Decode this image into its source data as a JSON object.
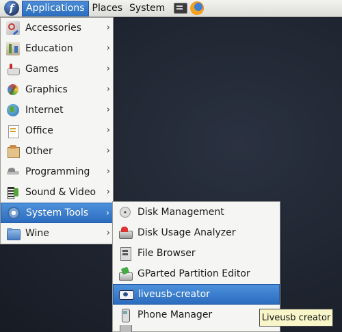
{
  "panel": {
    "menus": [
      "Applications",
      "Places",
      "System"
    ],
    "icons": [
      "fedora-logo-icon",
      "terminal-icon",
      "firefox-icon"
    ],
    "logo_letter": "f"
  },
  "applications_menu": {
    "items": [
      {
        "label": "Accessories",
        "icon": "accessories-icon"
      },
      {
        "label": "Education",
        "icon": "education-icon"
      },
      {
        "label": "Games",
        "icon": "games-icon"
      },
      {
        "label": "Graphics",
        "icon": "graphics-icon"
      },
      {
        "label": "Internet",
        "icon": "internet-icon"
      },
      {
        "label": "Office",
        "icon": "office-icon"
      },
      {
        "label": "Other",
        "icon": "other-icon"
      },
      {
        "label": "Programming",
        "icon": "programming-icon"
      },
      {
        "label": "Sound & Video",
        "icon": "sound-video-icon"
      },
      {
        "label": "System Tools",
        "icon": "system-tools-icon",
        "highlighted": true
      },
      {
        "label": "Wine",
        "icon": "wine-folder-icon"
      }
    ],
    "chevron": "›"
  },
  "system_tools_menu": {
    "items": [
      {
        "label": "Disk Management",
        "icon": "disk-icon"
      },
      {
        "label": "Disk Usage Analyzer",
        "icon": "disk-usage-icon"
      },
      {
        "label": "File Browser",
        "icon": "file-browser-icon"
      },
      {
        "label": "GParted Partition Editor",
        "icon": "gparted-icon"
      },
      {
        "label": "liveusb-creator",
        "icon": "liveusb-icon",
        "highlighted": true
      },
      {
        "label": "Phone Manager",
        "icon": "phone-icon"
      }
    ]
  },
  "tooltip": {
    "text": "Liveusb creator"
  },
  "colors": {
    "highlight": "#3a7bce",
    "menu_bg": "#f5f5f4",
    "desktop": "#1f2530",
    "tooltip_bg": "#f8f6c8"
  }
}
